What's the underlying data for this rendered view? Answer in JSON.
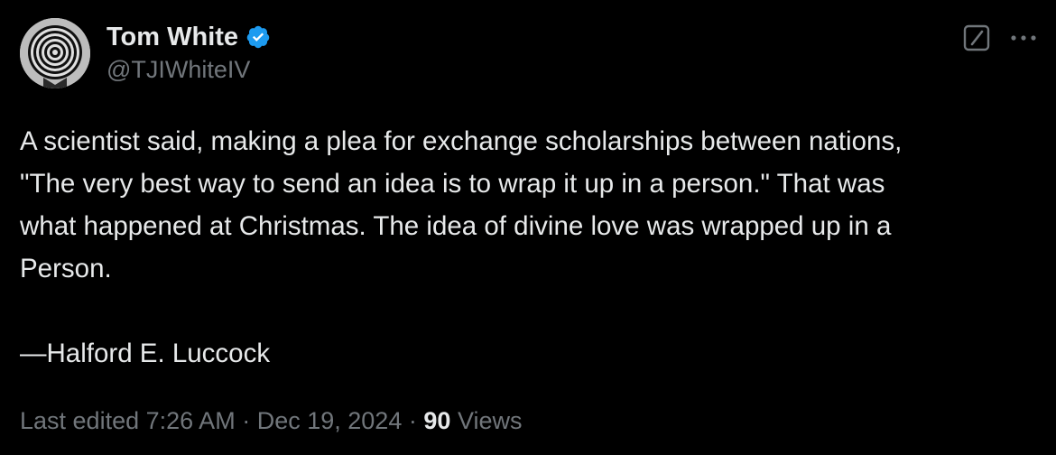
{
  "author": {
    "display_name": "Tom White",
    "handle": "@TJIWhiteIV",
    "verified": true,
    "verified_color": "#1d9bf0"
  },
  "header_actions": {
    "grok_icon": "grok-icon",
    "more_icon": "more-horizontal-icon"
  },
  "tweet": {
    "text": "A scientist said, making a plea for exchange scholarships between nations,\n\"The very best way to send an idea is to wrap it up in a person.\" That was\nwhat happened at Christmas. The idea of divine love was wrapped up in a\nPerson.\n\n—Halford E. Luccock"
  },
  "meta": {
    "edited_label": "Last edited",
    "time": "7:26 AM",
    "separator": "·",
    "date": "Dec 19, 2024",
    "views_count": "90",
    "views_label": "Views"
  },
  "colors": {
    "background": "#000000",
    "primary_text": "#e7e9ea",
    "secondary_text": "#71767b"
  }
}
